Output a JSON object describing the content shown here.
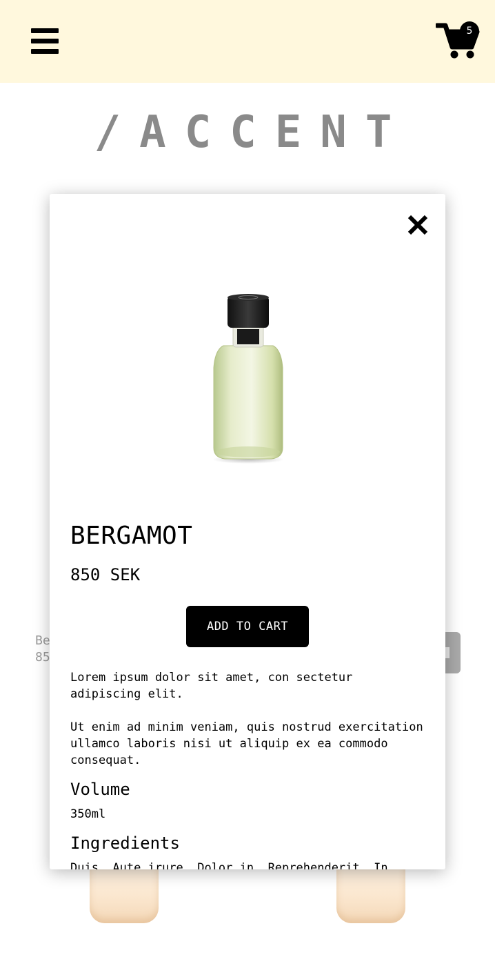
{
  "header": {
    "menu_icon": "hamburger-menu-icon",
    "cart_icon": "shopping-cart-icon",
    "cart_count": "5"
  },
  "logo": {
    "text": "/ACCENT"
  },
  "background_grid": {
    "card_name_partial": "Be",
    "card_price_partial": "85"
  },
  "modal": {
    "close_icon": "close-icon",
    "product": {
      "name": "BERGAMOT",
      "price": "850 SEK",
      "add_to_cart_label": "ADD TO CART",
      "description_1": "Lorem ipsum dolor sit amet, con sectetur adipiscing elit.",
      "description_2": "Ut enim ad minim veniam, quis nostrud exercitation ullamco laboris nisi ut aliquip ex ea commodo consequat.",
      "volume_heading": "Volume",
      "volume_value": "350ml",
      "ingredients_heading": "Ingredients",
      "ingredients_value": "Duis, Aute irure, Dolor in, Reprehenderit, In"
    }
  },
  "colors": {
    "header_bg": "#fff8dd",
    "button_bg": "#000000",
    "logo_color": "#8a8a8a"
  }
}
